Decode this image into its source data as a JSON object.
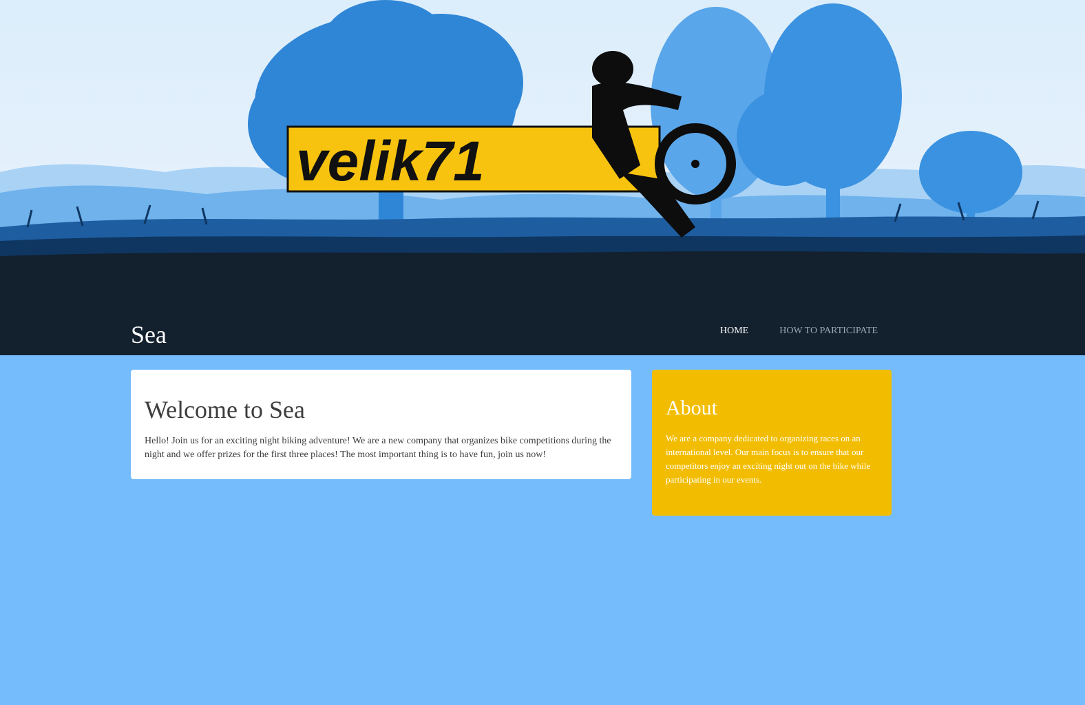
{
  "site": {
    "title": "Sea"
  },
  "banner": {
    "logo_text": "velik71"
  },
  "nav": {
    "items": [
      "HOME",
      "HOW TO PARTICIPATE"
    ]
  },
  "welcome": {
    "heading": "Welcome to Sea",
    "text": "Hello! Join us for an exciting night biking adventure! We are a new company that organizes bike competitions during the night and we offer prizes for the first three places! The most important thing is to have fun, join us now!"
  },
  "about": {
    "heading": "About",
    "text": "We are a company dedicated to organizing races on an international level. Our main focus is to ensure that our competitors enjoy an exciting night out on the bike while participating in our events."
  },
  "colors": {
    "page_background": "#74bcfc",
    "header_background": "#13202e",
    "about_background": "#f2bd01",
    "logo_yellow": "#f7c30e"
  }
}
